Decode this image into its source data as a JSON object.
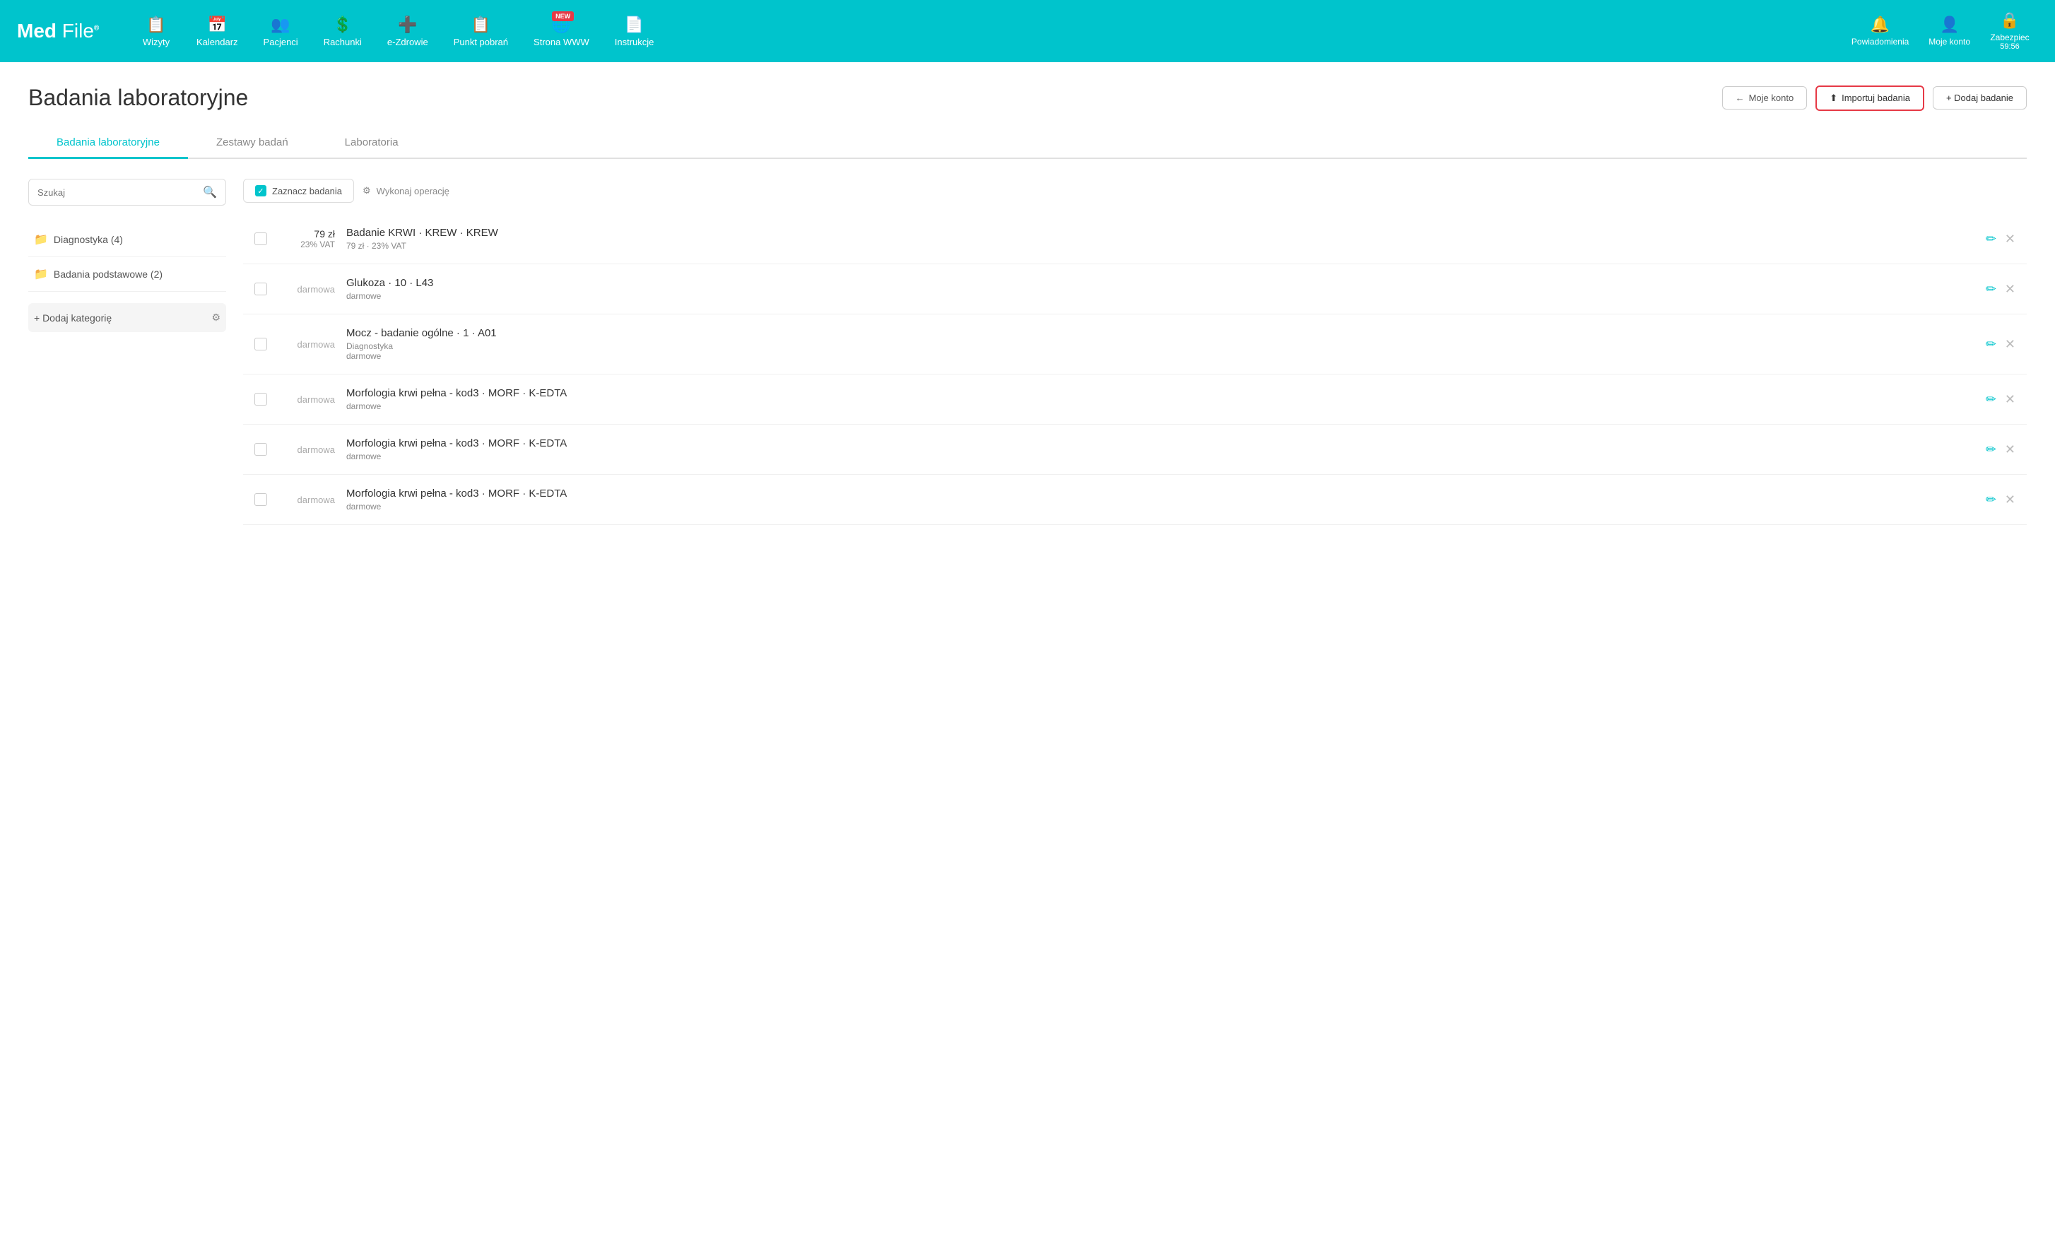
{
  "app": {
    "name": "Med File",
    "logo_r": "®"
  },
  "nav": {
    "items": [
      {
        "id": "wizyty",
        "label": "Wizyty",
        "icon": "📋"
      },
      {
        "id": "kalendarz",
        "label": "Kalendarz",
        "icon": "📅"
      },
      {
        "id": "pacjenci",
        "label": "Pacjenci",
        "icon": "👥"
      },
      {
        "id": "rachunki",
        "label": "Rachunki",
        "icon": "💲"
      },
      {
        "id": "e-zdrowie",
        "label": "e-Zdrowie",
        "icon": "➕"
      },
      {
        "id": "punkt-pobran",
        "label": "Punkt pobrań",
        "icon": "📋"
      },
      {
        "id": "strona-www",
        "label": "Strona WWW",
        "icon": "🌐",
        "badge": "NEW"
      },
      {
        "id": "instrukcje",
        "label": "Instrukcje",
        "icon": "📄"
      }
    ],
    "right_items": [
      {
        "id": "powiadomienia",
        "label": "Powiadomienia",
        "icon": "🔔"
      },
      {
        "id": "moje-konto",
        "label": "Moje konto",
        "icon": "👤"
      },
      {
        "id": "zabezpiec",
        "label": "Zabezpiec",
        "icon": "🔒",
        "timer": "59:56"
      }
    ]
  },
  "page": {
    "title": "Badania laboratoryjne",
    "buttons": {
      "moje_konto": "Moje konto",
      "importuj": "Importuj badania",
      "dodaj": "+ Dodaj badanie"
    }
  },
  "tabs": [
    {
      "id": "badania",
      "label": "Badania laboratoryjne",
      "active": true
    },
    {
      "id": "zestawy",
      "label": "Zestawy badań",
      "active": false
    },
    {
      "id": "laboratoria",
      "label": "Laboratoria",
      "active": false
    }
  ],
  "sidebar": {
    "search_placeholder": "Szukaj",
    "categories": [
      {
        "id": "diagnostyka",
        "label": "Diagnostyka (4)"
      },
      {
        "id": "podstawowe",
        "label": "Badania podstawowe (2)"
      }
    ],
    "add_category_label": "+ Dodaj kategorię"
  },
  "toolbar": {
    "zaznacz_label": "Zaznacz badania",
    "wykonaj_label": "Wykonaj operację"
  },
  "list_items": [
    {
      "id": 1,
      "price_main": "79 zł",
      "price_sub": "23% VAT",
      "is_free": false,
      "name": "Badanie KRWI · KREW · KREW",
      "sub": "79 zł · 23% VAT",
      "category": ""
    },
    {
      "id": 2,
      "price_free": "darmowa",
      "is_free": true,
      "name": "Glukoza · 10 · L43",
      "sub": "darmowe",
      "category": ""
    },
    {
      "id": 3,
      "price_free": "darmowa",
      "is_free": true,
      "name": "Mocz - badanie ogólne · 1 · A01",
      "sub": "darmowe",
      "category": "Diagnostyka"
    },
    {
      "id": 4,
      "price_free": "darmowa",
      "is_free": true,
      "name": "Morfologia krwi pełna - kod3 · MORF · K-EDTA",
      "sub": "darmowe",
      "category": ""
    },
    {
      "id": 5,
      "price_free": "darmowa",
      "is_free": true,
      "name": "Morfologia krwi pełna - kod3 · MORF · K-EDTA",
      "sub": "darmowe",
      "category": ""
    },
    {
      "id": 6,
      "price_free": "darmowa",
      "is_free": true,
      "name": "Morfologia krwi pełna - kod3 · MORF · K-EDTA",
      "sub": "darmowe",
      "category": ""
    }
  ]
}
